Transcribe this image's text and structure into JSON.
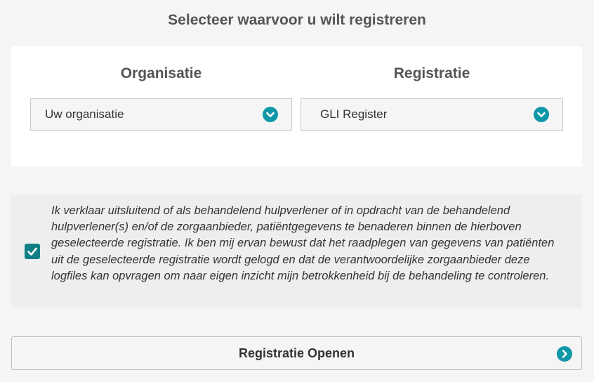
{
  "page": {
    "title": "Selecteer waarvoor u wilt registreren"
  },
  "organisation": {
    "heading": "Organisatie",
    "selected": "Uw organisatie",
    "icon": "chevron-down-icon"
  },
  "registration": {
    "heading": "Registratie",
    "selected": "GLI Register",
    "icon": "chevron-down-icon"
  },
  "consent": {
    "checked": true,
    "text": "Ik verklaar uitsluitend of als behandelend hulpverlener of in opdracht van de behandelend hulpverlener(s) en/of de zorgaanbieder, patiëntgegevens te benaderen binnen de hierboven geselecteerde registratie. Ik ben mij ervan bewust dat het raadplegen van gegevens van patiënten uit de geselecteerde registratie wordt gelogd en dat de verantwoordelijke zorgaanbieder deze logfiles kan opvragen om naar eigen inzicht mijn betrokkenheid bij de behandeling te controleren."
  },
  "open_button": {
    "label": "Registratie Openen",
    "icon": "chevron-right-icon"
  },
  "colors": {
    "accent": "#1097a8",
    "checkbox": "#0f7f86",
    "heading_text": "#555555",
    "body_text": "#333333",
    "page_background": "#f5f5f5",
    "panel_background": "#ffffff",
    "consent_background": "#eeeeee"
  }
}
